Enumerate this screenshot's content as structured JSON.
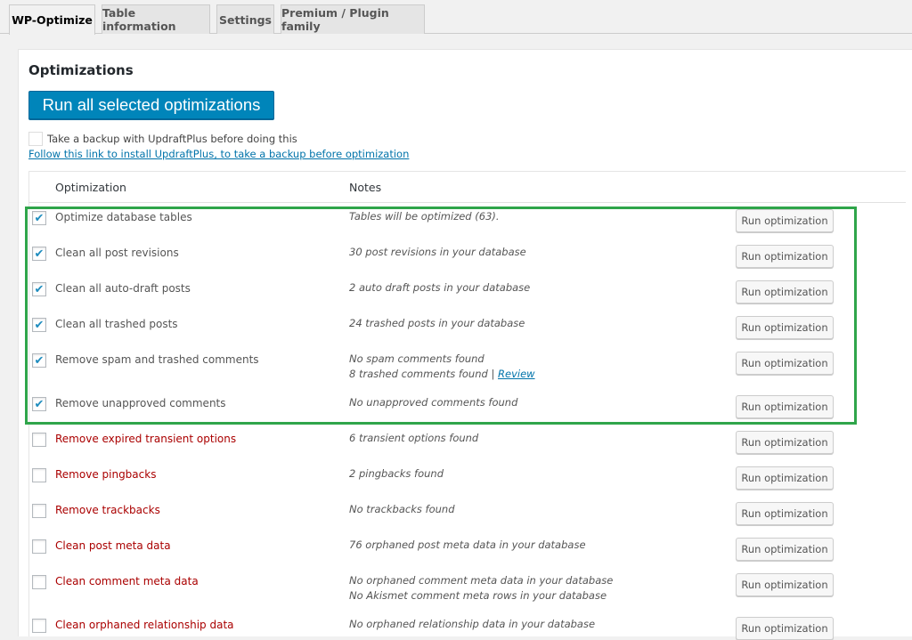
{
  "tabs": [
    {
      "label": "WP-Optimize",
      "active": true
    },
    {
      "label": "Table information",
      "active": false
    },
    {
      "label": "Settings",
      "active": false
    },
    {
      "label": "Premium / Plugin family",
      "active": false
    }
  ],
  "section": {
    "title": "Optimizations"
  },
  "run_all": {
    "label": "Run all selected optimizations"
  },
  "backup": {
    "checkbox_label": "Take a backup with UpdraftPlus before doing this",
    "link_text": "Follow this link to install UpdraftPlus, to take a backup before optimization"
  },
  "table": {
    "headers": {
      "optimization": "Optimization",
      "notes": "Notes"
    },
    "rows": [
      {
        "name": "Optimize database tables",
        "checked": true,
        "warning": false,
        "notes": [
          "Tables will be optimized (63)."
        ],
        "button": "Run optimization"
      },
      {
        "name": "Clean all post revisions",
        "checked": true,
        "warning": false,
        "notes": [
          "30 post revisions in your database"
        ],
        "button": "Run optimization"
      },
      {
        "name": "Clean all auto-draft posts",
        "checked": true,
        "warning": false,
        "notes": [
          "2 auto draft posts in your database"
        ],
        "button": "Run optimization"
      },
      {
        "name": "Clean all trashed posts",
        "checked": true,
        "warning": false,
        "notes": [
          "24 trashed posts in your database"
        ],
        "button": "Run optimization"
      },
      {
        "name": "Remove spam and trashed comments",
        "checked": true,
        "warning": false,
        "notes": [
          "No spam comments found",
          "8 trashed comments found | "
        ],
        "review_link": "Review",
        "button": "Run optimization"
      },
      {
        "name": "Remove unapproved comments",
        "checked": true,
        "warning": false,
        "notes": [
          "No unapproved comments found"
        ],
        "button": "Run optimization"
      },
      {
        "name": "Remove expired transient options",
        "checked": false,
        "warning": true,
        "notes": [
          "6 transient options found"
        ],
        "button": "Run optimization"
      },
      {
        "name": "Remove pingbacks",
        "checked": false,
        "warning": true,
        "notes": [
          "2 pingbacks found"
        ],
        "button": "Run optimization"
      },
      {
        "name": "Remove trackbacks",
        "checked": false,
        "warning": true,
        "notes": [
          "No trackbacks found"
        ],
        "button": "Run optimization"
      },
      {
        "name": "Clean post meta data",
        "checked": false,
        "warning": true,
        "notes": [
          "76 orphaned post meta data in your database"
        ],
        "button": "Run optimization"
      },
      {
        "name": "Clean comment meta data",
        "checked": false,
        "warning": true,
        "notes": [
          "No orphaned comment meta data in your database",
          "No Akismet comment meta rows in your database"
        ],
        "button": "Run optimization"
      },
      {
        "name": "Clean orphaned relationship data",
        "checked": false,
        "warning": true,
        "notes": [
          "No orphaned relationship data in your database"
        ],
        "button": "Run optimization"
      }
    ]
  },
  "colors": {
    "primary_button": "#0085ba",
    "link": "#0073aa",
    "warning_text": "#aa0000",
    "highlight_border": "#2fa54a",
    "checkmark": "#1e8cbe"
  }
}
